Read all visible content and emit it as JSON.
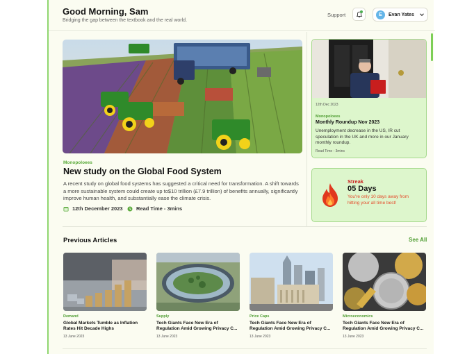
{
  "header": {
    "greeting": "Good Morning, Sam",
    "tagline": "Bridging the gap between the textbook and the real world.",
    "support_label": "Support",
    "user_name": "Evan Yates",
    "user_initial": "E"
  },
  "featured": {
    "category": "Monopoloees",
    "title": "New study on the Global Food System",
    "description": "A recent study on global food systems has suggested a critical need for transformation. A shift towards a more sustainable system could create up to$10 trillion (£7.9 trillion) of benefits annually, significantly improve human health, and substantially ease the climate crisis.",
    "date": "12th December 2023",
    "read_time": "Read Time - 3mins"
  },
  "roundup": {
    "date": "12th Dec 2023",
    "category": "Monopoloees",
    "title": "Monthly Roundup Nov 2023",
    "description": "Unemployment decrease in the US, IR cut speculation in the UK and more in our January monthly roundup.",
    "read_time": "Read Time - 3mins"
  },
  "streak": {
    "label": "Streak",
    "days": "05 Days",
    "message": "You're only 10 days away from hitting your all time best!"
  },
  "previous": {
    "title": "Previous Articles",
    "see_all": "See All",
    "articles": [
      {
        "category": "Demand",
        "title": "Global Markets Tumble as Inflation Rates Hit Decade Highs",
        "date": "13 June 2023"
      },
      {
        "category": "Supply",
        "title": "Tech Giants Face New Era of Regulation Amid Growing Privacy C...",
        "date": "13 June 2023"
      },
      {
        "category": "Price Caps",
        "title": "Tech Giants Face New Era of Regulation Amid Growing Privacy C...",
        "date": "13 June 2023"
      },
      {
        "category": "Microeconomics",
        "title": "Tech Giants Face New Era of Regulation Amid Growing Privacy C...",
        "date": "13 June 2023"
      }
    ]
  },
  "colors": {
    "accent_green": "#4f9d32",
    "card_green": "#ddf6cc",
    "streak_red": "#cc2020",
    "background": "#fbfcf1"
  },
  "icons": [
    "bell-icon",
    "chevron-down-icon",
    "calendar-icon",
    "clock-icon",
    "flame-icon"
  ]
}
